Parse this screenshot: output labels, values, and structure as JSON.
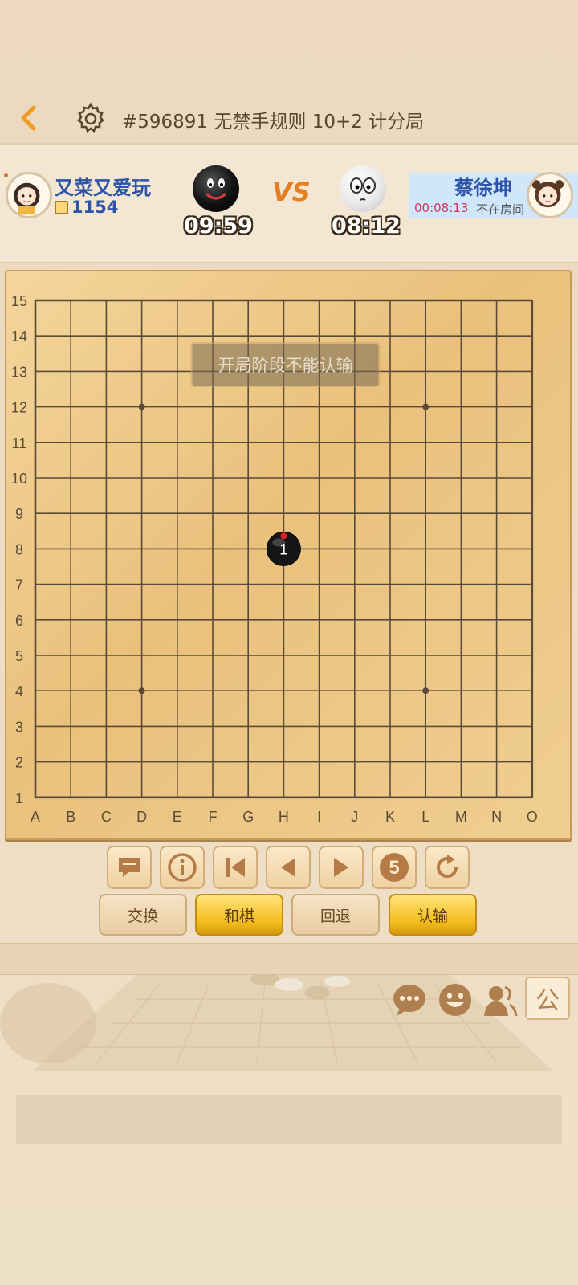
{
  "header": {
    "title": "#596891  无禁手规则  10+2 计分局"
  },
  "player_black": {
    "name": "又菜又爱玩",
    "score": "1154",
    "timer": "09:59"
  },
  "vs_label": "VS",
  "player_white": {
    "name": "蔡徐坤",
    "timer": "08:12",
    "room_timer": "00:08:13",
    "status": "不在房间"
  },
  "board": {
    "size": 15,
    "columns": [
      "A",
      "B",
      "C",
      "D",
      "E",
      "F",
      "G",
      "H",
      "I",
      "J",
      "K",
      "L",
      "M",
      "N",
      "O"
    ],
    "rows": [
      "15",
      "14",
      "13",
      "12",
      "11",
      "10",
      "9",
      "8",
      "7",
      "6",
      "5",
      "4",
      "3",
      "2",
      "1"
    ],
    "toast": "开局阶段不能认输",
    "star_points": [
      "D12",
      "L12",
      "D4",
      "L4"
    ],
    "stones": [
      {
        "move": "1",
        "color": "black",
        "position": "H8",
        "last_move": true
      }
    ]
  },
  "controls": {
    "icons": [
      "chat-bubble-icon",
      "info-icon",
      "first-move-icon",
      "prev-move-icon",
      "next-move-icon",
      "number-five-icon",
      "refresh-icon"
    ],
    "five_label": "5"
  },
  "actions": {
    "swap": "交换",
    "draw": "和棋",
    "undo": "回退",
    "resign": "认输"
  },
  "bottom_bar": {
    "public_label": "公"
  },
  "colors": {
    "name_blue": "#2e54a8",
    "accent_orange": "#e67e22",
    "timer_red": "#d6345a",
    "gold_button": "#f2bc1e"
  }
}
